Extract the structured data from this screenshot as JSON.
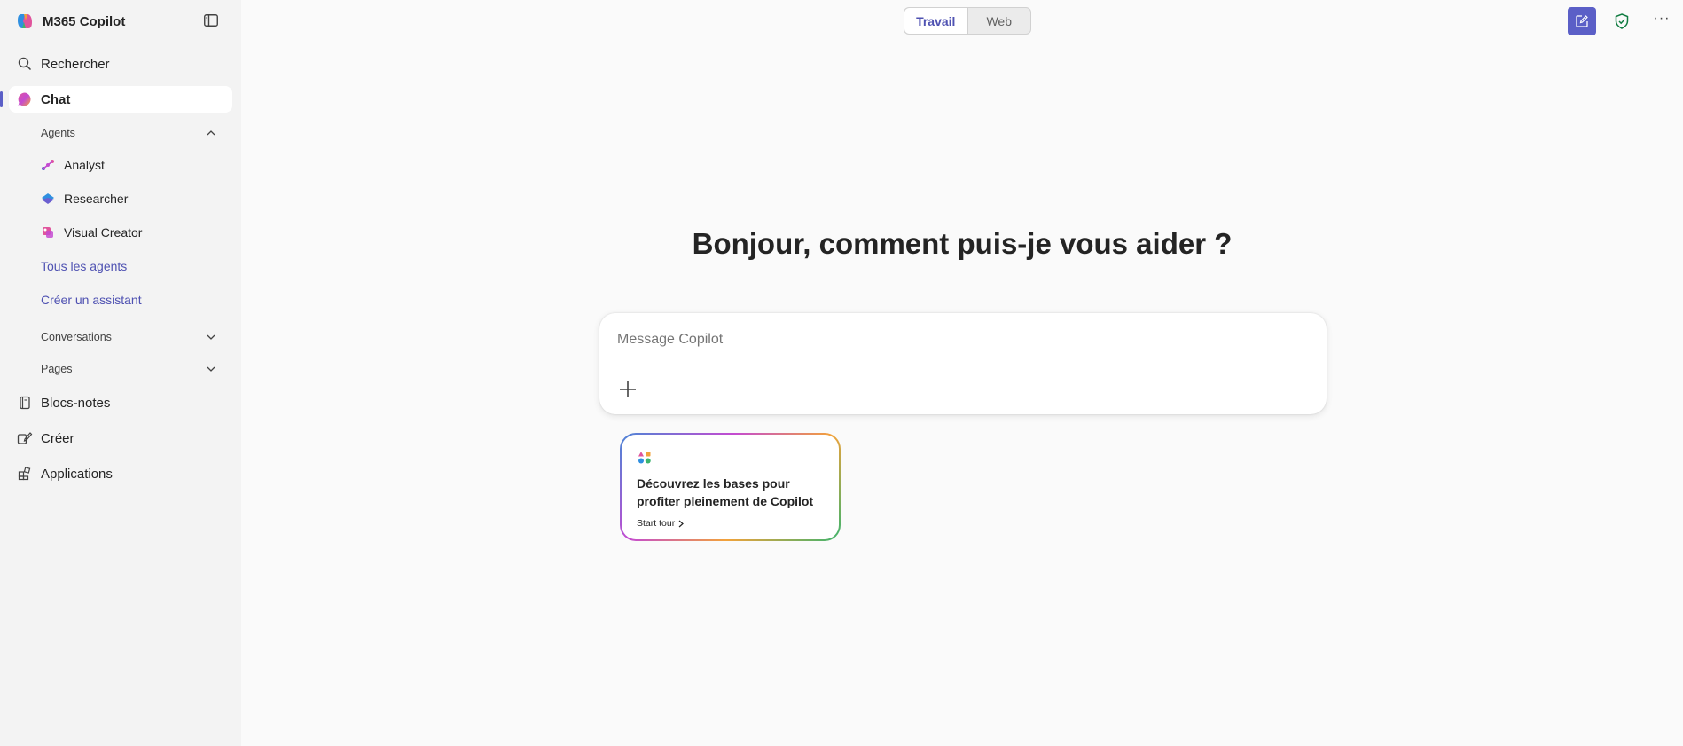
{
  "app": {
    "title": "M365 Copilot"
  },
  "sidebar": {
    "search_label": "Rechercher",
    "chat_label": "Chat",
    "agents_section": "Agents",
    "agents": [
      {
        "label": "Analyst",
        "icon": "analyst-icon"
      },
      {
        "label": "Researcher",
        "icon": "researcher-icon"
      },
      {
        "label": "Visual Creator",
        "icon": "visual-creator-icon"
      }
    ],
    "all_agents_link": "Tous les agents",
    "create_assistant_link": "Créer un assistant",
    "conversations_section": "Conversations",
    "pages_section": "Pages",
    "notebooks_label": "Blocs-notes",
    "create_label": "Créer",
    "apps_label": "Applications"
  },
  "topbar": {
    "mode_options": [
      "Travail",
      "Web"
    ],
    "selected_mode": "Travail",
    "accent_color": "#5b5fc7"
  },
  "main": {
    "greeting": "Bonjour, comment puis-je vous aider ?",
    "composer_placeholder": "Message Copilot",
    "tour_card": {
      "title": "Découvrez les bases pour profiter pleinement de Copilot",
      "link": "Start tour"
    }
  }
}
